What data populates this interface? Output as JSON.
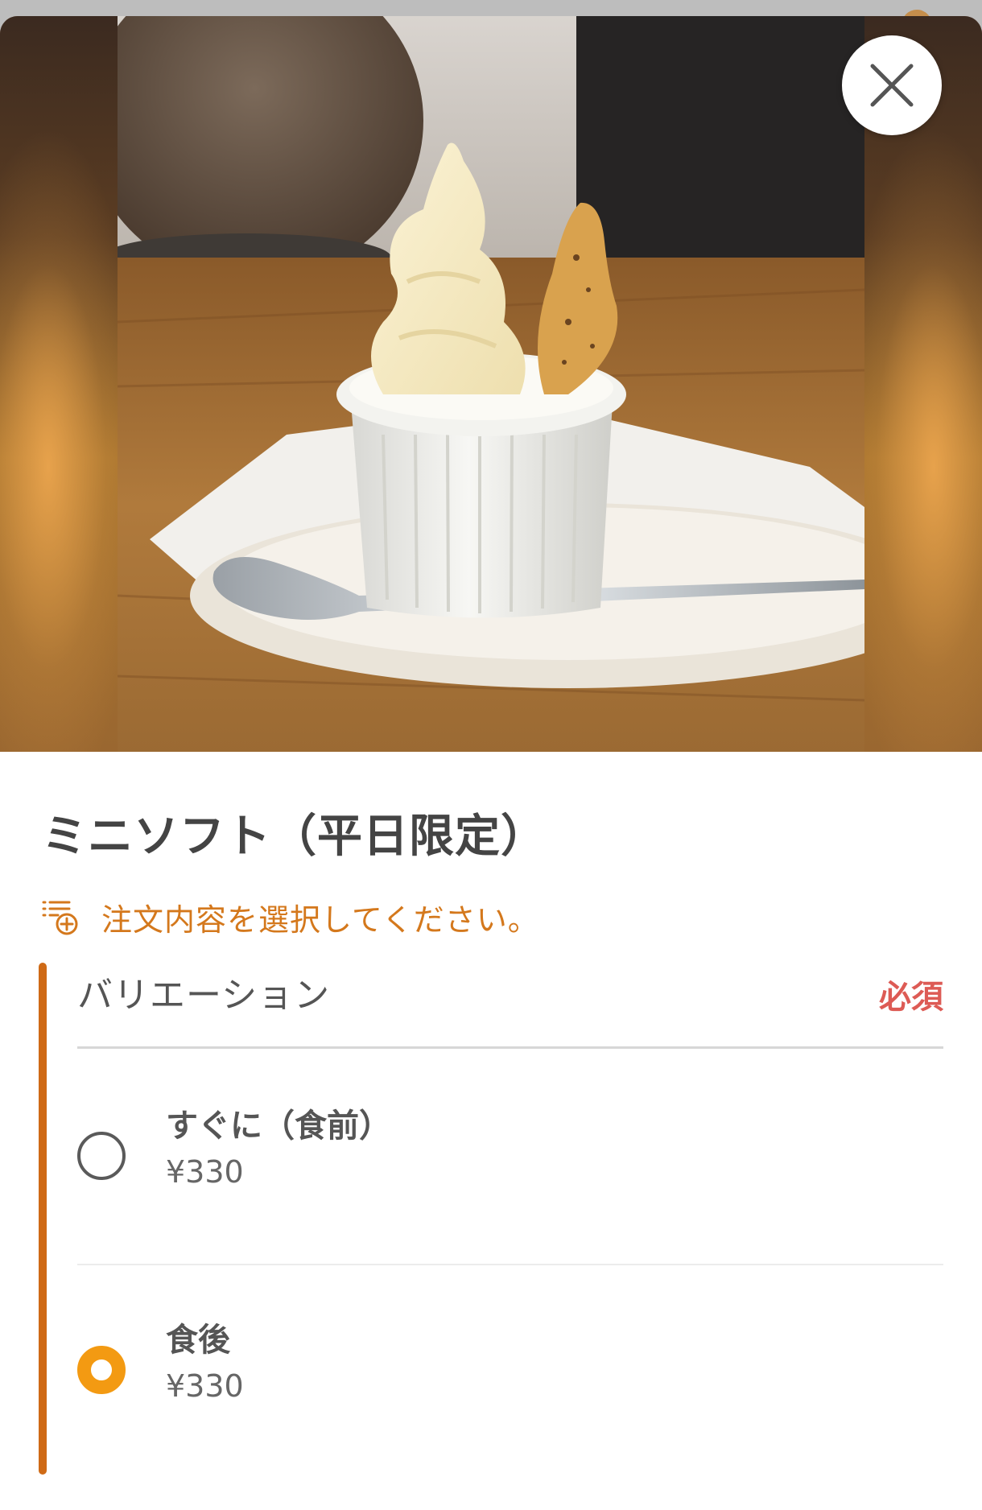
{
  "modal": {
    "close_icon": "close-icon",
    "photo_alt": "ice-cream-photo"
  },
  "item": {
    "title": "ミニソフト（平日限定）",
    "notice": "注文内容を選択してください。",
    "notice_icon": "list-add-icon"
  },
  "variation": {
    "title": "バリエーション",
    "required_label": "必須",
    "options": [
      {
        "name": "すぐに（食前）",
        "price": "¥330",
        "selected": false
      },
      {
        "name": "食後",
        "price": "¥330",
        "selected": true
      }
    ]
  },
  "colors": {
    "accent": "#cf6a16",
    "notice": "#d4781c",
    "required": "#dd5b55",
    "radio_selected": "#f39a12"
  }
}
